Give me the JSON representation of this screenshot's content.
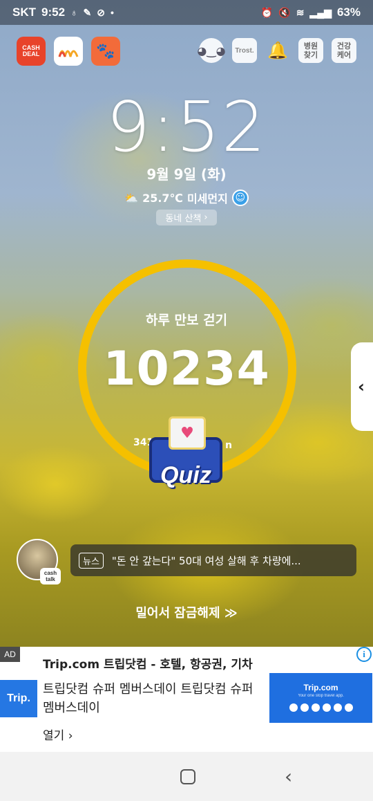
{
  "status_bar": {
    "carrier": "SKT",
    "time": "9:52",
    "battery": "63%"
  },
  "top_left_apps": [
    {
      "name": "cashdeal",
      "label_line1": "CASH",
      "label_line2": "DEAL"
    },
    {
      "name": "mm-app",
      "label": ""
    },
    {
      "name": "paw-app",
      "label": ""
    }
  ],
  "top_right_apps": [
    {
      "name": "face-app",
      "label": ""
    },
    {
      "name": "trost",
      "label": "Trost."
    },
    {
      "name": "bell-app",
      "label": ""
    },
    {
      "name": "hospital-finder",
      "label_line1": "병원",
      "label_line2": "찾기"
    },
    {
      "name": "health-care",
      "label_line1": "건강",
      "label_line2": "케어"
    }
  ],
  "clock": {
    "time": "9:52"
  },
  "date": "9월 9일 (화)",
  "weather": {
    "temperature": "25.7℃",
    "dust_label": "미세먼지"
  },
  "walk_chip": {
    "label": "동네 산책"
  },
  "steps": {
    "title": "하루 만보 걷기",
    "count": "10234",
    "sub_left": "341",
    "sub_right": "n"
  },
  "quiz": {
    "label": "Quiz"
  },
  "news": {
    "tag": "뉴스",
    "headline": "\"돈 안 갚는다\" 50대 여성 살해 후 차량에...",
    "badge_line1": "cash",
    "badge_line2": "talk"
  },
  "unlock": {
    "label": "밀어서 잠금해제"
  },
  "ad": {
    "tag": "AD",
    "logo": "Trip.",
    "title": "Trip.com 트립닷컴 - 호텔, 항공권, 기차",
    "description": "트립닷컴 슈퍼 멤버스데이 트립닷컴 슈퍼 멤버스데이",
    "open_label": "열기",
    "banner_title": "Trip.com",
    "banner_subtitle": "Your one stop travel app."
  },
  "colors": {
    "ring": "#f5c000",
    "ad_blue": "#2577e3",
    "dust_good": "#3aa0e8"
  }
}
